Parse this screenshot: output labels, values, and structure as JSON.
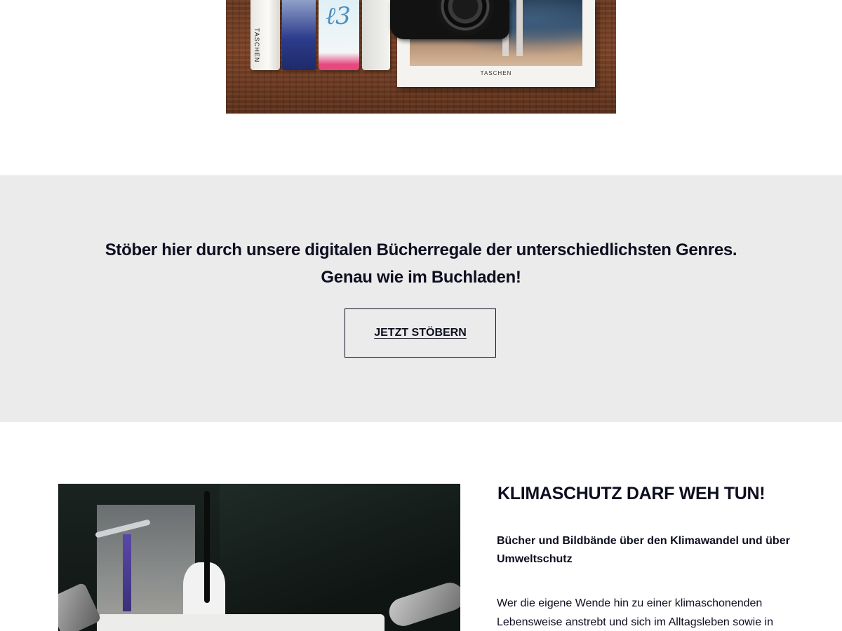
{
  "hero": {
    "book_spine_label": "TASCHEN",
    "book_cover_label": "TASCHEN"
  },
  "cta": {
    "heading_line1": "Stöber hier durch unsere digitalen Bücherregale der unterschiedlichsten Genres.",
    "heading_line2": "Genau wie im Buchladen!",
    "button_label": "JETZT STÖBERN"
  },
  "climate": {
    "title": "KLIMASCHUTZ DARF WEH TUN!",
    "subtitle": "Bücher und Bildbände über den Klimawandel und über Umweltschutz",
    "body": "Wer die eigene Wende hin zu einer klimaschonenden Lebensweise anstrebt und sich im Alltagsleben sowie in seinem politischen"
  }
}
